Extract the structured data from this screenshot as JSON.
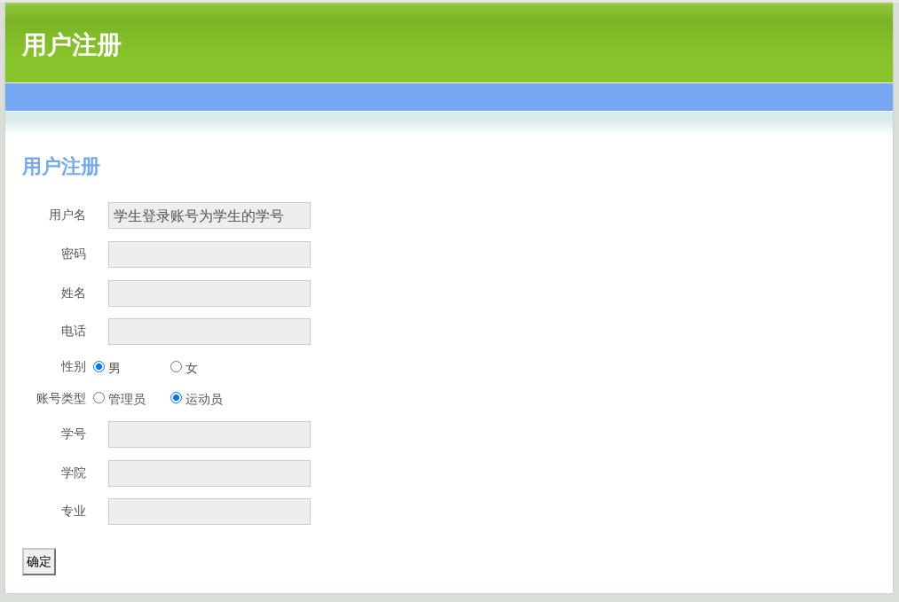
{
  "header": {
    "title": "用户注册"
  },
  "form": {
    "heading": "用户注册",
    "fields": [
      {
        "kind": "text",
        "label": "用户名",
        "placeholder": "学生登录账号为学生的学号"
      },
      {
        "kind": "text",
        "label": "密码"
      },
      {
        "kind": "text",
        "label": "姓名"
      },
      {
        "kind": "text",
        "label": "电话"
      },
      {
        "kind": "radio",
        "label": "性别",
        "options": [
          {
            "label": "男",
            "selected": true
          },
          {
            "label": "女",
            "selected": false
          }
        ]
      },
      {
        "kind": "radio",
        "label": "账号类型",
        "options": [
          {
            "label": "管理员",
            "selected": false
          },
          {
            "label": "运动员",
            "selected": true
          }
        ]
      },
      {
        "kind": "text",
        "label": "学号"
      },
      {
        "kind": "text",
        "label": "学院"
      },
      {
        "kind": "text",
        "label": "专业"
      }
    ],
    "submit_button": "确定"
  }
}
